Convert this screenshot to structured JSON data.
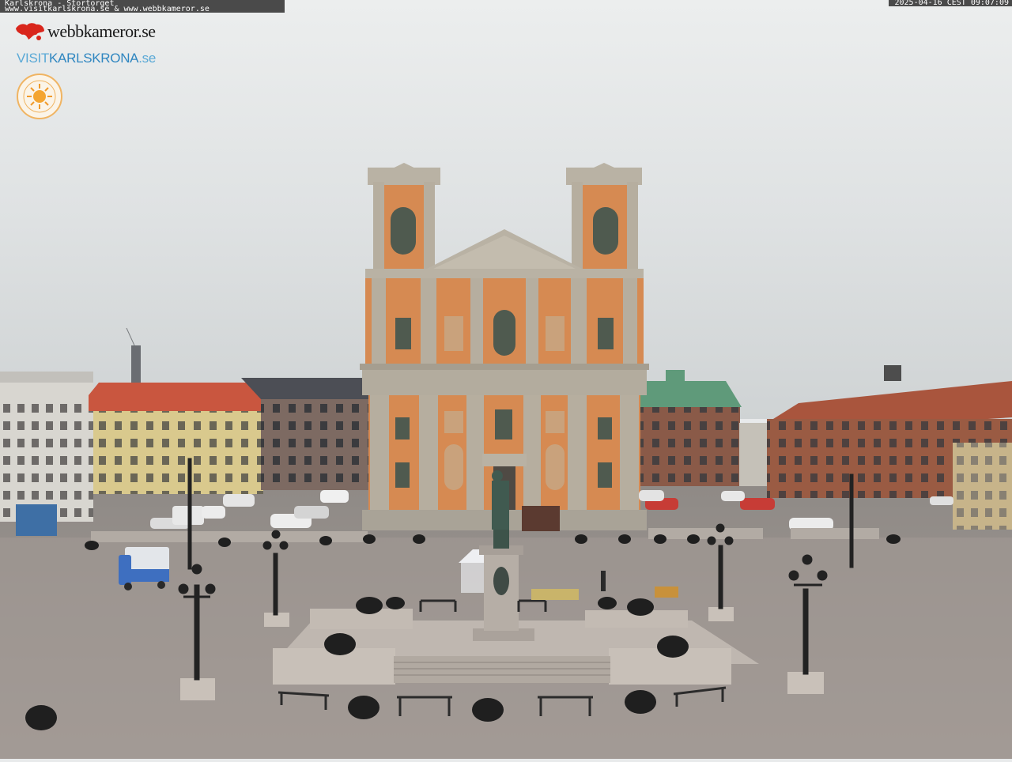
{
  "overlay": {
    "caption_line1": "Karlskrona - Stortorget",
    "caption_line2": "www.visitkarlskrona.se & www.webbkameror.se",
    "timestamp": "2025-04-16 CEST 09:07:09"
  },
  "logos": {
    "webbkameror": "webbkameror.se",
    "visit_prefix": "VISIT",
    "visit_name": "KARLSKRONA",
    "visit_suffix": ".se"
  },
  "colors": {
    "sky": "#e6e9ea",
    "church_ochre": "#d88a52",
    "stone": "#b9b2a4",
    "copper_roof": "#5f9a7a",
    "red_roof": "#c9563f",
    "square": "#9c9590"
  }
}
